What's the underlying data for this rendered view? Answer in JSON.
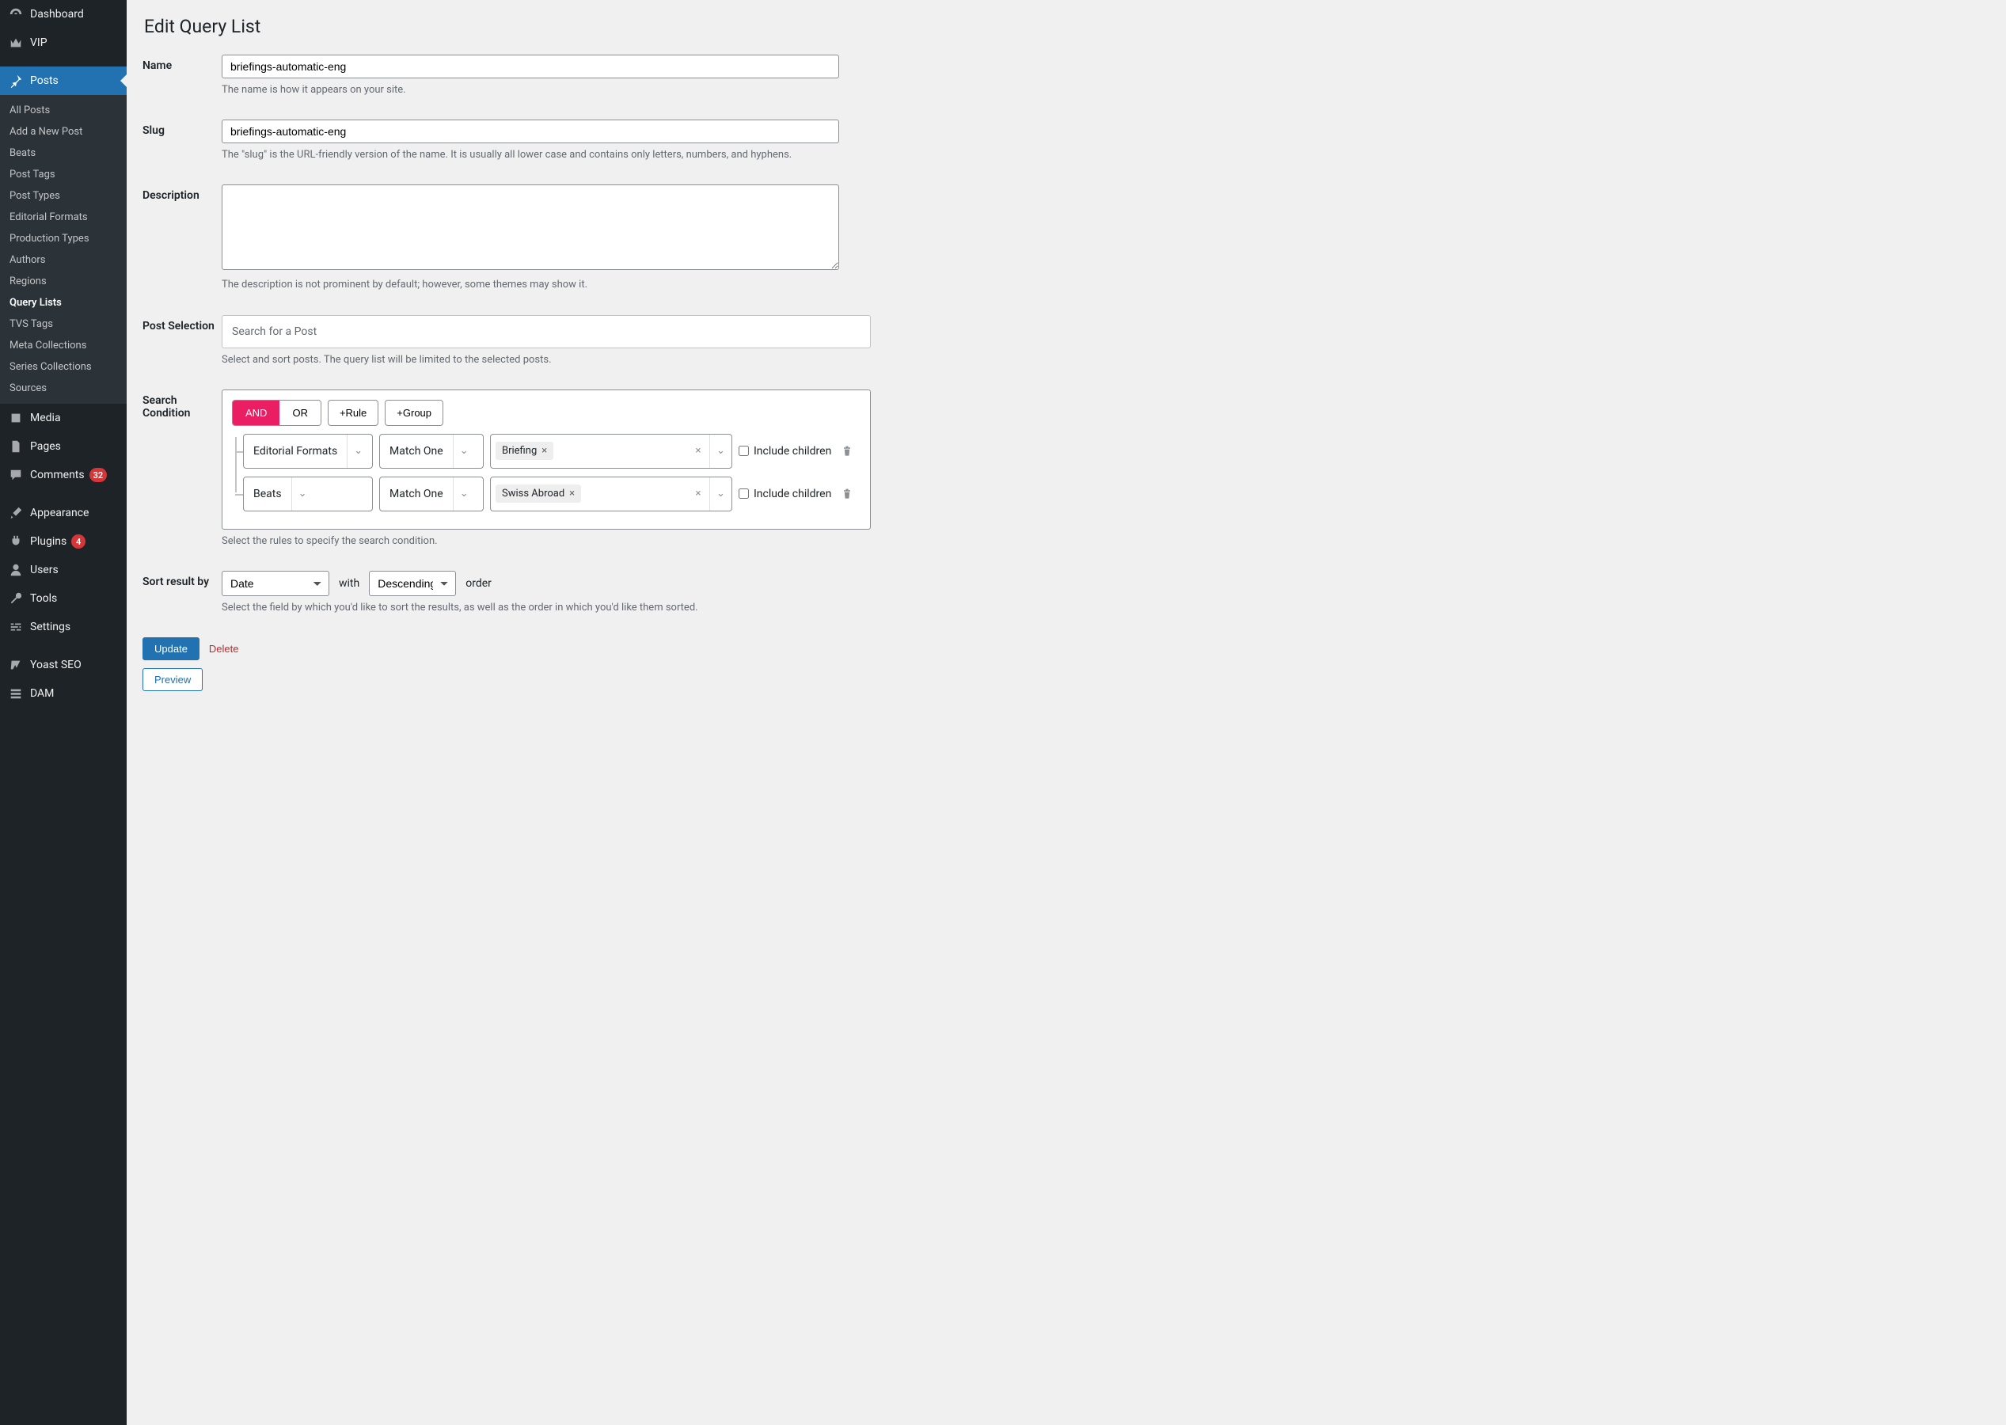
{
  "sidebar": {
    "items": [
      {
        "label": "Dashboard",
        "icon": "dashboard"
      },
      {
        "label": "VIP",
        "icon": "vip"
      },
      {
        "label": "Posts",
        "icon": "pin",
        "active": true,
        "sub": [
          {
            "label": "All Posts"
          },
          {
            "label": "Add a New Post"
          },
          {
            "label": "Beats"
          },
          {
            "label": "Post Tags"
          },
          {
            "label": "Post Types"
          },
          {
            "label": "Editorial Formats"
          },
          {
            "label": "Production Types"
          },
          {
            "label": "Authors"
          },
          {
            "label": "Regions"
          },
          {
            "label": "Query Lists",
            "current": true
          },
          {
            "label": "TVS Tags"
          },
          {
            "label": "Meta Collections"
          },
          {
            "label": "Series Collections"
          },
          {
            "label": "Sources"
          }
        ]
      },
      {
        "label": "Media",
        "icon": "media"
      },
      {
        "label": "Pages",
        "icon": "page"
      },
      {
        "label": "Comments",
        "icon": "comment",
        "badge": "32"
      },
      {
        "label": "Appearance",
        "icon": "brush"
      },
      {
        "label": "Plugins",
        "icon": "plug",
        "badge": "4"
      },
      {
        "label": "Users",
        "icon": "user"
      },
      {
        "label": "Tools",
        "icon": "wrench"
      },
      {
        "label": "Settings",
        "icon": "sliders"
      },
      {
        "label": "Yoast SEO",
        "icon": "yoast"
      },
      {
        "label": "DAM",
        "icon": "dam"
      }
    ]
  },
  "page": {
    "title": "Edit Query List",
    "name": {
      "label": "Name",
      "value": "briefings-automatic-eng",
      "desc": "The name is how it appears on your site."
    },
    "slug": {
      "label": "Slug",
      "value": "briefings-automatic-eng",
      "desc": "The \"slug\" is the URL-friendly version of the name. It is usually all lower case and contains only letters, numbers, and hyphens."
    },
    "description": {
      "label": "Description",
      "value": "",
      "desc": "The description is not prominent by default; however, some themes may show it."
    },
    "post_selection": {
      "label": "Post Selection",
      "placeholder": "Search for a Post",
      "desc": "Select and sort posts. The query list will be limited to the selected posts."
    },
    "search_condition": {
      "label": "Search Condition",
      "logic_and": "AND",
      "logic_or": "OR",
      "add_rule": "+Rule",
      "add_group": "+Group",
      "rules": [
        {
          "field": "Editorial Formats",
          "op": "Match One",
          "tags": [
            "Briefing"
          ],
          "include_children_label": "Include children",
          "include_children": false
        },
        {
          "field": "Beats",
          "op": "Match One",
          "tags": [
            "Swiss Abroad"
          ],
          "include_children_label": "Include children",
          "include_children": false
        }
      ],
      "desc": "Select the rules to specify the search condition."
    },
    "sort": {
      "label": "Sort result by",
      "field": "Date",
      "with": "with",
      "direction": "Descending",
      "order": "order",
      "desc": "Select the field by which you'd like to sort the results, as well as the order in which you'd like them sorted."
    },
    "actions": {
      "update": "Update",
      "delete": "Delete",
      "preview": "Preview"
    }
  }
}
